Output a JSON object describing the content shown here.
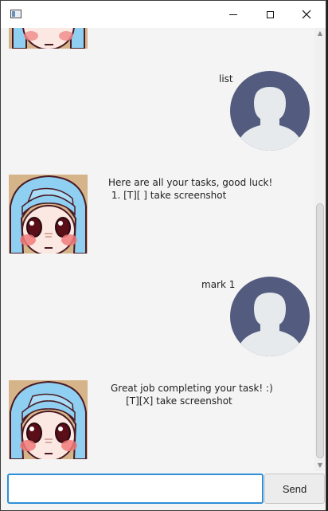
{
  "window": {
    "title": "",
    "icon": "app-window-icon",
    "controls": [
      "minimize-icon",
      "maximize-icon",
      "close-icon"
    ]
  },
  "messages": [
    {
      "sender": "duke",
      "text": ""
    },
    {
      "sender": "user",
      "text": "list"
    },
    {
      "sender": "duke",
      "text": "Here are all your tasks, good luck!\n 1. [T][ ] take screenshot"
    },
    {
      "sender": "user",
      "text": "mark 1"
    },
    {
      "sender": "duke",
      "text": "Great job completing your task! :)\n     [T][X] take screenshot"
    }
  ],
  "input": {
    "value": "",
    "placeholder": ""
  },
  "send_button": {
    "label": "Send"
  },
  "colors": {
    "accent": "#2f8fd8",
    "user_avatar_bg": "#535b7f",
    "user_avatar_fg": "#e6eaed",
    "duke_hair": "#8fd0f2",
    "background": "#f4f4f4"
  }
}
